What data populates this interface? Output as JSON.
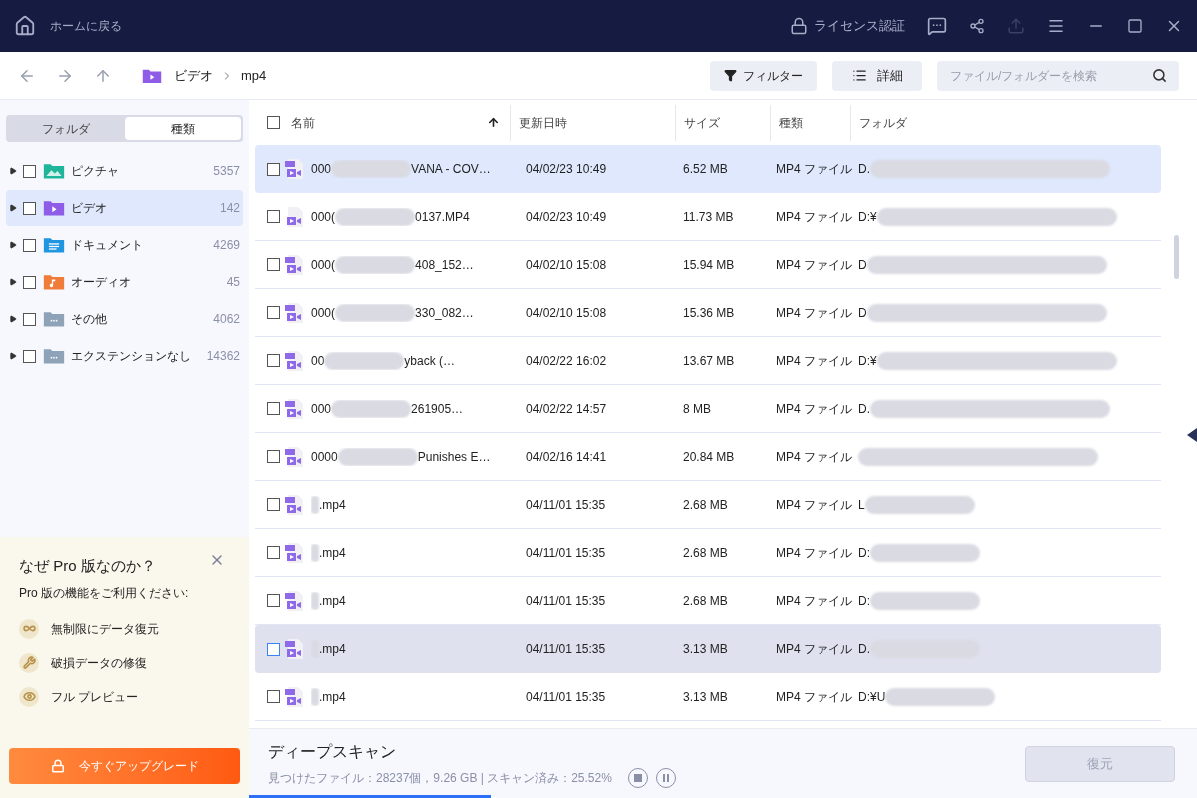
{
  "title_bar": {
    "home_label": "ホームに戻る",
    "license_label": "ライセンス認証"
  },
  "toolbar": {
    "breadcrumb": [
      "ビデオ",
      "mp4"
    ],
    "filter_button": "フィルター",
    "details_button": "詳細",
    "search": {
      "placeholder": "ファイル/フォルダーを検索"
    }
  },
  "sidebar": {
    "tabs": [
      {
        "label": "フォルダ",
        "selected": false
      },
      {
        "label": "種類",
        "selected": true
      }
    ],
    "items": [
      {
        "label": "ピクチャ",
        "count": "5357",
        "kind": "picture",
        "color": "#1fb59a",
        "selected": false,
        "checked": false
      },
      {
        "label": "ビデオ",
        "count": "142",
        "kind": "video",
        "color": "#8f5ce8",
        "selected": true,
        "checked": false
      },
      {
        "label": "ドキュメント",
        "count": "4269",
        "kind": "document",
        "color": "#2196e0",
        "selected": false,
        "checked": false
      },
      {
        "label": "オーディオ",
        "count": "45",
        "kind": "audio",
        "color": "#f07c3a",
        "selected": false,
        "checked": false
      },
      {
        "label": "その他",
        "count": "4062",
        "kind": "other",
        "color": "#8fa3b8",
        "selected": false,
        "checked": false
      },
      {
        "label": "エクステンションなし",
        "count": "14362",
        "kind": "other",
        "color": "#8fa3b8",
        "selected": false,
        "checked": false
      }
    ],
    "promo": {
      "title": "なぜ Pro 版なのか？",
      "subtitle": "Pro 版の機能をご利用ください:",
      "features": [
        {
          "label": "無制限にデータ復元",
          "kind": "infinity"
        },
        {
          "label": "破損データの修復",
          "kind": "wrench"
        },
        {
          "label": "フル プレビュー",
          "kind": "eye"
        }
      ],
      "upgrade_button": "今すぐアップグレード"
    }
  },
  "table": {
    "all_checked": false,
    "columns": [
      {
        "label": "名前",
        "sorted": true
      },
      {
        "label": "更新日時",
        "sorted": false
      },
      {
        "label": "サイズ",
        "sorted": false
      },
      {
        "label": "種類",
        "sorted": false
      },
      {
        "label": "フォルダ",
        "sorted": false
      }
    ],
    "rows": [
      {
        "name_start": "000",
        "name_end": "VANA - COV…",
        "date": "04/02/23 10:49",
        "size": "6.52 MB",
        "type": "MP4 ファイル",
        "folder": "D.",
        "kind": "mp4",
        "selected": true,
        "hovered": false,
        "checked": false
      },
      {
        "name_start": "000(",
        "name_end": "0137.MP4",
        "date": "04/02/23 10:49",
        "size": "11.73 MB",
        "type": "MP4 ファイル",
        "folder": "D:¥",
        "kind": "video",
        "selected": false,
        "hovered": false,
        "checked": false
      },
      {
        "name_start": "000(",
        "name_end": "408_152…",
        "date": "04/02/10 15:08",
        "size": "15.94 MB",
        "type": "MP4 ファイル",
        "folder": "D",
        "kind": "mp4",
        "selected": false,
        "hovered": false,
        "checked": false
      },
      {
        "name_start": "000(",
        "name_end": "330_082…",
        "date": "04/02/10 15:08",
        "size": "15.36 MB",
        "type": "MP4 ファイル",
        "folder": "D",
        "kind": "mp4",
        "selected": false,
        "hovered": false,
        "checked": false
      },
      {
        "name_start": "00",
        "name_end": "yback (…",
        "date": "04/02/22 16:02",
        "size": "13.67 MB",
        "type": "MP4 ファイル",
        "folder": "D:¥",
        "kind": "mp4",
        "selected": false,
        "hovered": false,
        "checked": false
      },
      {
        "name_start": "000",
        "name_end": "261905…",
        "date": "04/02/22 14:57",
        "size": "8 MB",
        "type": "MP4 ファイル",
        "folder": "D.",
        "kind": "mp4",
        "selected": false,
        "hovered": false,
        "checked": false
      },
      {
        "name_start": "0000",
        "name_end": "Punishes E…",
        "date": "04/02/16 14:41",
        "size": "20.84 MB",
        "type": "MP4 ファイル",
        "kind": "mp4",
        "selected": false,
        "hovered": false,
        "checked": false
      },
      {
        "name_end": ".mp4",
        "date": "04/11/01 15:35",
        "size": "2.68 MB",
        "type": "MP4 ファイル",
        "folder": "L",
        "kind": "mp4",
        "selected": false,
        "hovered": false,
        "checked": false
      },
      {
        "name_end": ".mp4",
        "date": "04/11/01 15:35",
        "size": "2.68 MB",
        "type": "MP4 ファイル",
        "folder": "D:",
        "kind": "mp4",
        "selected": false,
        "hovered": false,
        "checked": false
      },
      {
        "name_end": ".mp4",
        "date": "04/11/01 15:35",
        "size": "2.68 MB",
        "type": "MP4 ファイル",
        "folder": "D:",
        "kind": "mp4",
        "selected": false,
        "hovered": false,
        "checked": false
      },
      {
        "name_end": ".mp4",
        "date": "04/11/01 15:35",
        "size": "3.13 MB",
        "type": "MP4 ファイル",
        "folder": "D.",
        "kind": "mp4",
        "selected": false,
        "hovered": true,
        "checked": false
      },
      {
        "name_end": ".mp4",
        "date": "04/11/01 15:35",
        "size": "3.13 MB",
        "type": "MP4 ファイル",
        "folder": "D:¥U",
        "kind": "mp4",
        "selected": false,
        "hovered": false,
        "checked": false
      }
    ]
  },
  "status": {
    "title": "ディープスキャン",
    "summary": "見つけたファイル：28237個，9.26 GB | スキャン済み：25.52%",
    "level": 0.2552,
    "recover_button": "復元",
    "recover_disabled": true
  }
}
